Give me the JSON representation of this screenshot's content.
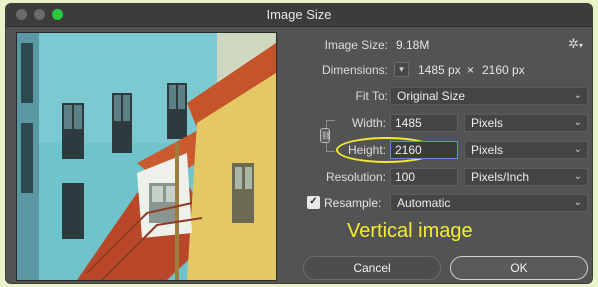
{
  "window": {
    "title": "Image Size"
  },
  "image_size": {
    "label": "Image Size:",
    "value": "9.18M"
  },
  "dimensions": {
    "label": "Dimensions:",
    "width": "1485 px",
    "times": "×",
    "height": "2160 px",
    "icon": "chevron-down-icon"
  },
  "fit_to": {
    "label": "Fit To:",
    "value": "Original Size"
  },
  "width": {
    "label": "Width:",
    "value": "1485",
    "unit": "Pixels"
  },
  "height": {
    "label": "Height:",
    "value": "2160",
    "unit": "Pixels"
  },
  "resolution": {
    "label": "Resolution:",
    "value": "100",
    "unit": "Pixels/Inch"
  },
  "resample": {
    "label": "Resample:",
    "checked": true,
    "value": "Automatic"
  },
  "annotation": {
    "caption": "Vertical image",
    "color": "#f4ee2f"
  },
  "buttons": {
    "cancel": "Cancel",
    "ok": "OK"
  }
}
